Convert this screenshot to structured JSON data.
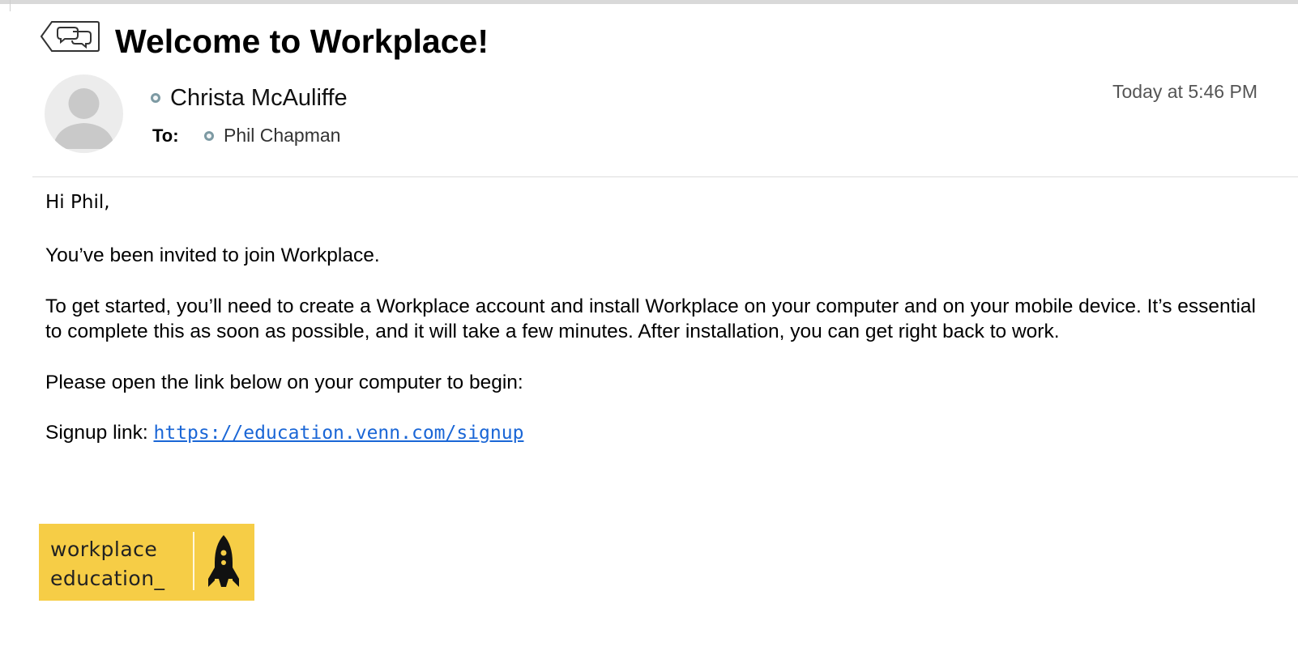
{
  "email": {
    "subject": "Welcome to Workplace!",
    "sender": {
      "name": "Christa McAuliffe",
      "status_color": "#7d9aa3"
    },
    "recipients": {
      "label": "To:",
      "name": "Phil Chapman"
    },
    "timestamp": "Today at 5:46 PM",
    "body": {
      "greeting": "Hi Phil,",
      "paragraph1": "You’ve been invited to join Workplace.",
      "paragraph2": "To get started, you’ll need to create a Workplace account and install Workplace on your computer and on your mobile device. It’s essential to complete this as soon as possible, and it will take a few minutes. After installation, you can get right back to work.",
      "paragraph3": "Please open the link below on your computer to begin:",
      "signup_label": "Signup link:",
      "signup_url": "https://education.venn.com/signup",
      "link_color": "#1a66d6"
    },
    "logo": {
      "line1": "workplace",
      "line2": "education_",
      "background": "#f6cd46",
      "icon": "rocket-icon"
    },
    "thread_icon": "conversation-icon"
  }
}
